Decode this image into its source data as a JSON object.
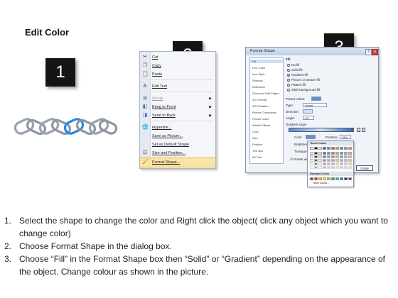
{
  "page": {
    "title": "Edit Color"
  },
  "badges": [
    "1",
    "2",
    "3"
  ],
  "context_menu": {
    "items": [
      {
        "label": "Cut",
        "icon": "scissors-icon",
        "glyph": "✂",
        "color": "#333333",
        "disabled": false,
        "submenu": false
      },
      {
        "label": "Copy",
        "icon": "copy-icon",
        "glyph": "❐",
        "color": "#4a6fa5",
        "disabled": false,
        "submenu": false
      },
      {
        "label": "Paste",
        "icon": "paste-icon",
        "glyph": "📋",
        "color": "#b07b2a",
        "disabled": false,
        "submenu": false
      },
      {
        "label": "Edit Text",
        "icon": "edit-text-icon",
        "glyph": "A",
        "color": "#333333",
        "disabled": false,
        "submenu": false
      },
      {
        "label": "Group",
        "icon": "group-icon",
        "glyph": "▣",
        "color": "#999999",
        "disabled": true,
        "submenu": true
      },
      {
        "label": "Bring to Front",
        "icon": "bring-to-front-icon",
        "glyph": "◧",
        "color": "#3c6eb4",
        "disabled": false,
        "submenu": true
      },
      {
        "label": "Send to Back",
        "icon": "send-to-back-icon",
        "glyph": "◨",
        "color": "#3c6eb4",
        "disabled": false,
        "submenu": true
      },
      {
        "label": "Hyperlink...",
        "icon": "hyperlink-icon",
        "glyph": "🌐",
        "color": "#2f7a3a",
        "disabled": false,
        "submenu": false
      },
      {
        "label": "Save as Picture...",
        "icon": "",
        "glyph": "",
        "color": "#333333",
        "disabled": false,
        "submenu": false
      },
      {
        "label": "Set as Default Shape",
        "icon": "",
        "glyph": "",
        "color": "#333333",
        "disabled": false,
        "submenu": false
      },
      {
        "label": "Size and Position...",
        "icon": "size-position-icon",
        "glyph": "⊡",
        "color": "#333333",
        "disabled": false,
        "submenu": false
      },
      {
        "label": "Format Shape...",
        "icon": "format-shape-icon",
        "glyph": "🖌",
        "color": "#b5651d",
        "disabled": false,
        "submenu": false,
        "highlighted": true
      }
    ]
  },
  "dialog": {
    "title": "Format Shape",
    "help": "?",
    "close": "X",
    "nav": [
      "Fill",
      "Line Color",
      "Line Style",
      "Shadow",
      "Reflection",
      "Glow and Soft Edges",
      "3-D Format",
      "3-D Rotation",
      "Picture Corrections",
      "Picture Color",
      "Artistic Effects",
      "Crop",
      "Size",
      "Position",
      "Text Box",
      "Alt Text"
    ],
    "section": "Fill",
    "options": [
      "No fill",
      "Solid fill",
      "Gradient fill",
      "Picture or texture fill",
      "Pattern fill",
      "Slide background fill"
    ],
    "selected_option": "Gradient fill",
    "preset_label": "Preset colors:",
    "type_label": "Type:",
    "type_value": "Linear",
    "direction_label": "Direction:",
    "angle_label": "Angle:",
    "angle_value": "90°",
    "stops_label": "Gradient stops",
    "color_label": "Color",
    "position_label": "Position:",
    "position_value": "78%",
    "brightness_label": "Brightness:",
    "transparency_label": "Transparency:",
    "rotate_label": "Rotate with shape",
    "close_button": "Close"
  },
  "palette": {
    "theme_label": "Theme Colors",
    "standard_label": "Standard Colors",
    "more_label": "More Colors...",
    "theme_top": [
      "#ffffff",
      "#000000",
      "#eeece1",
      "#1f497d",
      "#4f81bd",
      "#c0504d",
      "#9bbb59",
      "#8064a2",
      "#4bacc6",
      "#f79646"
    ],
    "standard": [
      "#c00000",
      "#ff0000",
      "#ffc000",
      "#ffff00",
      "#92d050",
      "#00b050",
      "#00b0f0",
      "#0070c0",
      "#002060",
      "#7030a0"
    ]
  },
  "instructions": [
    {
      "num": "1.",
      "text": "Select the shape to change the color and Right click the object( click any object which you want to change color)"
    },
    {
      "num": "2.",
      "text": "Choose Format Shape in the dialog box."
    },
    {
      "num": "3.",
      "text": "Choose “Fill” in the Format Shape box then “Solid” or “Gradient” depending on the appearance of the object. Change colour as shown in the picture."
    }
  ],
  "colors": {
    "chain_gray": "#9aa3ad",
    "chain_blue": "#2e86de",
    "badge_bg": "#151515"
  }
}
